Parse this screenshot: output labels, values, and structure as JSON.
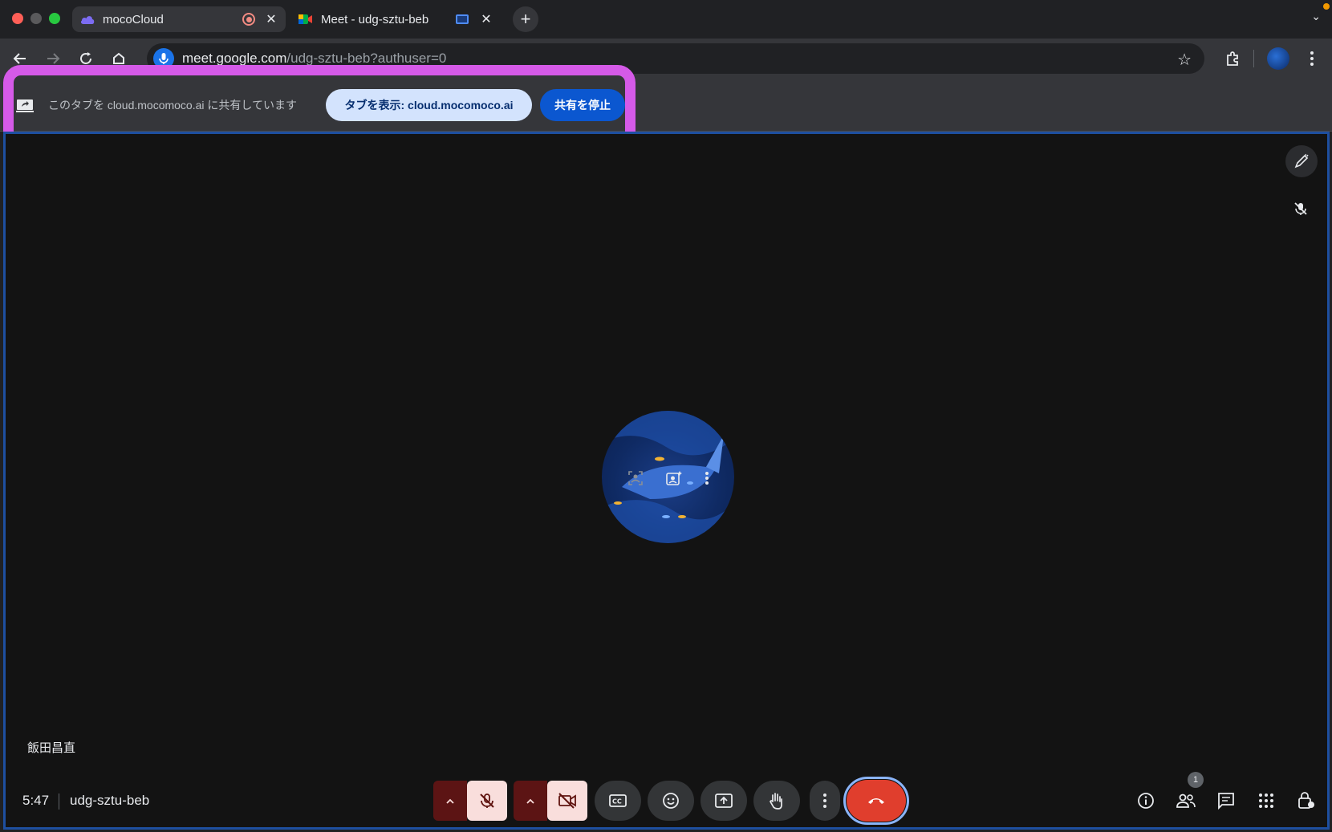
{
  "browser": {
    "tabs": [
      {
        "title": "mocoCloud",
        "active": true
      },
      {
        "title": "Meet - udg-sztu-beb",
        "active": false
      }
    ],
    "url_host": "meet.google.com",
    "url_path": "/udg-sztu-beb?authuser=0"
  },
  "share_bar": {
    "message": "このタブを cloud.mocomoco.ai に共有しています",
    "show_tab_label": "タブを表示: cloud.mocomoco.ai",
    "stop_label": "共有を停止"
  },
  "meeting": {
    "participant_name": "飯田昌直",
    "time": "5:47",
    "code": "udg-sztu-beb",
    "participant_count": "1"
  },
  "colors": {
    "highlight": "#d55ae8",
    "end_call": "#e03e2d",
    "primary_button": "#0b57d0",
    "tonal_button": "#d3e3fd"
  },
  "icons": [
    "mococloud-favicon",
    "recording-icon",
    "close-icon",
    "meet-favicon",
    "cast-icon",
    "new-tab-icon",
    "back-icon",
    "forward-icon",
    "reload-icon",
    "home-icon",
    "mic-icon",
    "star-icon",
    "extensions-icon",
    "profile-avatar",
    "menu-icon",
    "share-screen-icon",
    "pen-icon",
    "mic-off-icon",
    "camera-off-icon",
    "captions-icon",
    "emoji-icon",
    "present-icon",
    "raise-hand-icon",
    "more-icon",
    "end-call-icon",
    "info-icon",
    "people-icon",
    "chat-icon",
    "apps-icon",
    "host-controls-icon"
  ]
}
